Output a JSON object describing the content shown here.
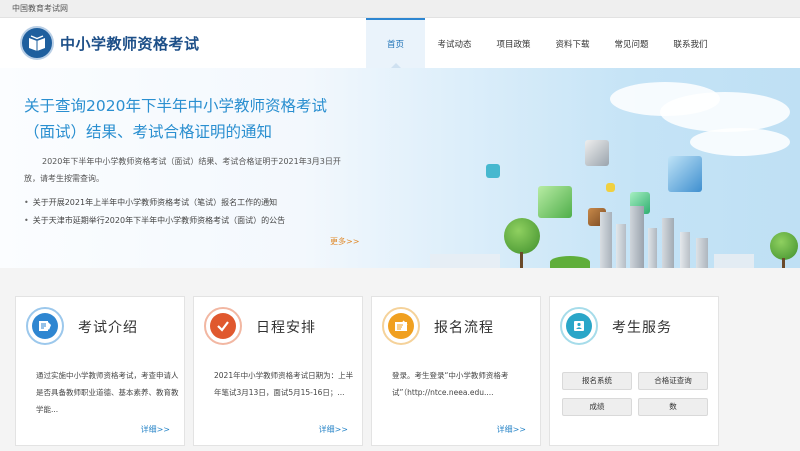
{
  "top_bar": {
    "site_label": "中国教育考试网"
  },
  "header": {
    "title": "中小学教师资格考试"
  },
  "nav": {
    "items": [
      {
        "label": "首页",
        "active": true
      },
      {
        "label": "考试动态"
      },
      {
        "label": "项目政策"
      },
      {
        "label": "资料下载"
      },
      {
        "label": "常见问题"
      },
      {
        "label": "联系我们"
      }
    ]
  },
  "banner": {
    "title": "关于查询2020年下半年中小学教师资格考试（面试）结果、考试合格证明的通知",
    "description": "2020年下半年中小学教师资格考试（面试）结果、考试合格证明于2021年3月3日开放，请考生按需查询。",
    "news": [
      "关于开展2021年上半年中小学教师资格考试（笔试）报名工作的通知",
      "关于天津市延期举行2020年下半年中小学教师资格考试（面试）的公告"
    ],
    "more_label": "更多>>"
  },
  "cards": [
    {
      "title": "考试介绍",
      "text": "通过实施中小学教师资格考试，考查申请人是否具备教师职业道德、基本素养、教育教学能...",
      "detail_label": "详细>>",
      "icon": "book-icon",
      "color": "#2e86d1"
    },
    {
      "title": "日程安排",
      "text": "2021年中小学教师资格考试日期为：上半年笔试3月13日，面试5月15-16日；...",
      "detail_label": "详细>>",
      "icon": "checkmark-icon",
      "color": "#e0582e"
    },
    {
      "title": "报名流程",
      "text": "登录。考生登录“中小学教师资格考试”（http://ntce.neea.edu....",
      "detail_label": "详细>>",
      "icon": "signup-form-icon",
      "color": "#f0a020"
    },
    {
      "title": "考生服务",
      "icon": "id-card-icon",
      "color": "#2aa6c8",
      "buttons": [
        "报名系统",
        "合格证查询",
        "成绩",
        "数"
      ]
    }
  ]
}
